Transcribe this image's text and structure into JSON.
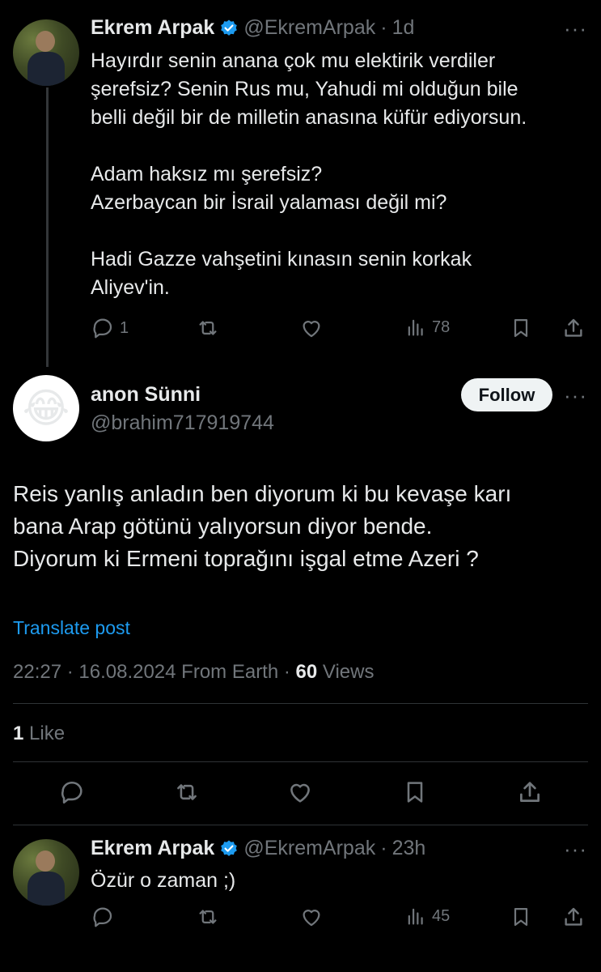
{
  "reply1": {
    "name": "Ekrem Arpak",
    "handle": "@EkremArpak",
    "time": "1d",
    "text": "Hayırdır senin anana çok mu elektirik verdiler\nşerefsiz? Senin Rus mu, Yahudi mi olduğun bile\nbelli değil bir de milletin anasına küfür ediyorsun.\n\nAdam haksız mı şerefsiz?\nAzerbaycan bir İsrail yalaması değil mi?\n\nHadi Gazze vahşetini kınasın senin korkak\nAliyev'in.",
    "replies": "1",
    "views": "78",
    "accent": "#1d9bf0"
  },
  "main": {
    "name": "anon Sünni",
    "handle": "@brahim717919744",
    "avatar_emoji": "😂",
    "follow_label": "Follow",
    "text": "Reis yanlış anladın ben diyorum ki bu kevaşe karı\nbana Arap götünü yalıyorsun diyor bende.\nDiyorum ki Ermeni toprağını işgal etme Azeri ?",
    "translate_label": "Translate post",
    "timestamp": "22:27 · 16.08.2024 From Earth · ",
    "views_count": "60",
    "views_label": " Views",
    "likes_count": "1",
    "likes_label": " Like"
  },
  "reply2": {
    "name": "Ekrem Arpak",
    "handle": "@EkremArpak",
    "time": "23h",
    "text": "Özür o zaman ;)",
    "views": "45"
  },
  "icons": {
    "more": "more-icon",
    "reply": "reply-icon",
    "repost": "repost-icon",
    "like": "like-icon",
    "views": "views-icon",
    "bookmark": "bookmark-icon",
    "share": "share-icon",
    "verified": "verified-badge-icon"
  }
}
